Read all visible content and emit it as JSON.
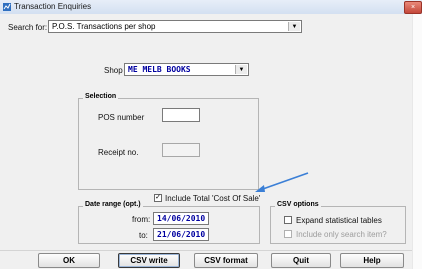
{
  "window": {
    "title": "Transaction Enquiries",
    "close_glyph": "×"
  },
  "search": {
    "label": "Search for:",
    "value": "P.O.S. Transactions per shop"
  },
  "shop": {
    "label": "Shop",
    "value": "ME MELB BOOKS"
  },
  "selection": {
    "title": "Selection",
    "pos_label": "POS number",
    "pos_value": "",
    "receipt_label": "Receipt no.",
    "receipt_value": ""
  },
  "include_cost": {
    "label": "Include Total 'Cost Of Sale'",
    "checked": true,
    "check_glyph": "✓"
  },
  "date_range": {
    "title": "Date range (opt.)",
    "from_label": "from:",
    "from_value": "14/06/2010",
    "to_label": "to:",
    "to_value": "21/06/2010"
  },
  "csv_options": {
    "title": "CSV options",
    "expand_label": "Expand statistical tables",
    "expand_checked": false,
    "only_label": "Include only search item?",
    "only_checked": false
  },
  "buttons": {
    "ok": "OK",
    "csv_write": "CSV write",
    "csv_format": "CSV format",
    "quit": "Quit",
    "help": "Help"
  },
  "colors": {
    "annotation_arrow": "#3b7fd6",
    "field_text": "#0000a0"
  },
  "icons": {
    "dropdown": "▼"
  }
}
